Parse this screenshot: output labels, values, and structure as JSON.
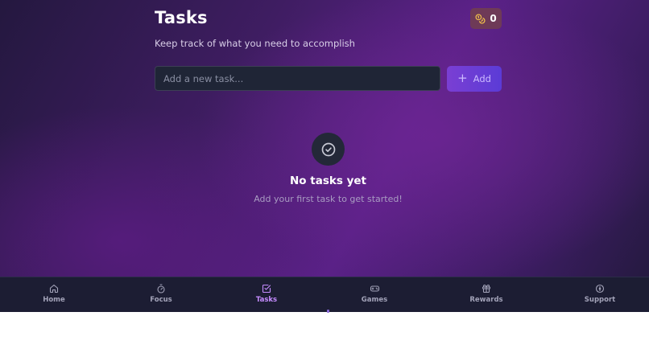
{
  "header": {
    "title": "Tasks",
    "subtitle": "Keep track of what you need to accomplish",
    "coins": {
      "count": "0",
      "icon": "coins-icon",
      "color": "#f3c24a"
    }
  },
  "task_form": {
    "placeholder": "Add a new task...",
    "value": "",
    "add_label": "Add",
    "add_icon": "plus-icon"
  },
  "empty_state": {
    "icon": "check-circle-icon",
    "title": "No tasks yet",
    "subtitle": "Add your first task to get started!"
  },
  "bottom_nav": {
    "active": "Tasks",
    "active_color": "#c58cff",
    "items": [
      {
        "label": "Home",
        "icon": "home-icon"
      },
      {
        "label": "Focus",
        "icon": "timer-icon"
      },
      {
        "label": "Tasks",
        "icon": "checkbox-icon"
      },
      {
        "label": "Games",
        "icon": "gamepad-icon"
      },
      {
        "label": "Rewards",
        "icon": "gift-icon"
      },
      {
        "label": "Support",
        "icon": "lifebuoy-icon"
      }
    ]
  },
  "colors": {
    "background_top": "#3f1d62",
    "background_accent": "#5a2187",
    "input_bg": "#1f2536",
    "button_gradient": [
      "#7a3fd3",
      "#5b3bd6"
    ],
    "nav_bg": "#1c1d33"
  }
}
